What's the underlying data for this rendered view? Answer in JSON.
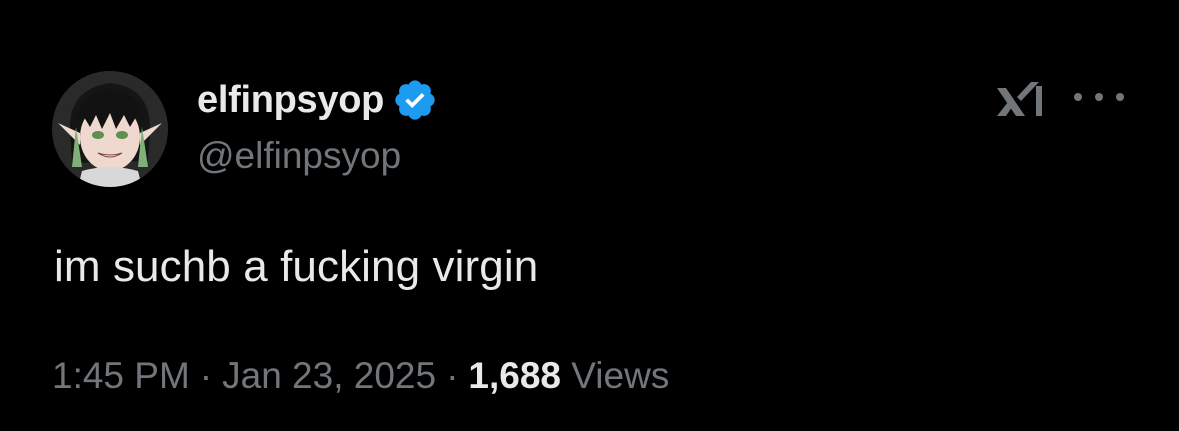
{
  "tweet": {
    "display_name": "elfinpsyop",
    "handle": "@elfinpsyop",
    "verified": true,
    "text": "im suchb a fucking virgin",
    "time": "1:45 PM",
    "separator": "·",
    "date": "Jan 23, 2025",
    "views_count": "1,688",
    "views_label": "Views"
  },
  "icons": {
    "avatar": "avatar-anime-elf",
    "verified": "verified-badge-icon",
    "logo": "xai-grok-logo-icon",
    "more": "more-horizontal-icon"
  },
  "colors": {
    "background": "#000000",
    "primary_text": "#e7e9ea",
    "secondary_text": "#71767b",
    "verified_blue": "#1d9bf0"
  }
}
